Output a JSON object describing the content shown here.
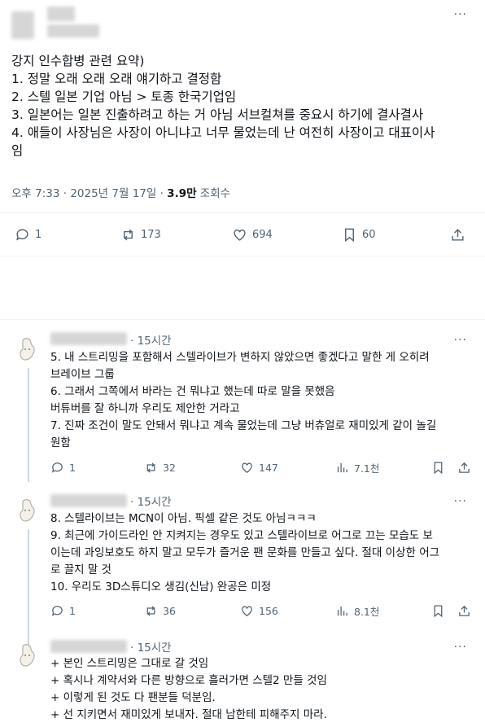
{
  "main_tweet": {
    "lines": [
      "강지 인수합병 관련 요약)",
      "1. 정말 오래 오래 오래 얘기하고 결정함",
      "2. 스텔 일본 기업 아님 > 토종 한국기업임",
      "3. 일본어는 일본 진출하려고 하는 거 아님 서브컬쳐를 중요시 하기에 결사결사",
      "4. 애들이 사장님은 사장이 아니냐고 너무 물었는데 난 여전히 사장이고 대표이사",
      "임"
    ],
    "time": "오후 7:33 · 2025년 7월 17일 · ",
    "views_count": "3.9만",
    "views_label": " 조회수",
    "replies": "1",
    "retweets": "173",
    "likes": "694",
    "bookmarks": "60"
  },
  "replies": [
    {
      "time": "· 15시간",
      "lines": [
        "5. 내 스트리밍을 포함해서 스텔라이브가 변하지 않았으면 좋겠다고 말한 게 오히려",
        "브레이브 그룹",
        "6. 그래서 그쪽에서 바라는 건 뭐냐고 했는데 따로 말을 못했음",
        "버튜버를 잘 하니까 우리도 제안한 거라고",
        "7. 진짜 조건이 말도 안돼서 뭐냐고 계속 물었는데 그냥 버츄얼로 재미있게 같이 놀길",
        "원함"
      ],
      "replies": "1",
      "retweets": "32",
      "likes": "147",
      "views": "7.1천"
    },
    {
      "time": "· 15시간",
      "lines": [
        "8. 스텔라이브는 MCN이 아님. 픽셀 같은 것도 아님ㅋㅋㅋ",
        "9. 최근에 가이드라인 안 지켜지는 경우도 있고 스텔라이브로 어그로 끄는 모습도 보",
        "이는데 과잉보호도 하지 말고 모두가 즐거운 팬 문화를 만들고 싶다. 절대 이상한 어그",
        "로 끌지 말 것",
        "10. 우리도 3D스튜디오 생김(신남) 완공은 미정"
      ],
      "replies": "1",
      "retweets": "36",
      "likes": "156",
      "views": "8.1천"
    },
    {
      "time": "· 15시간",
      "lines": [
        "+ 본인 스트리밍은 그대로 갈 것임",
        "+ 혹시나 계약서와 다른 방향으로 흘러가면 스텔2 만들 것임",
        "+ 이렇게 된 것도 다 팬분들 덕분임.",
        "+ 선 지키면서 재미있게 보내자. 절대 남한테 피해주지 마라."
      ]
    }
  ],
  "more_icon": "···"
}
